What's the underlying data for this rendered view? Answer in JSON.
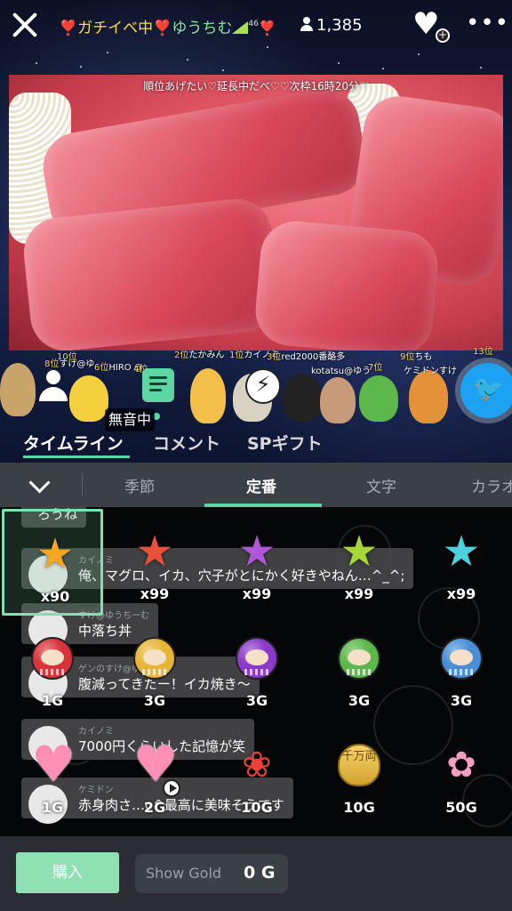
{
  "header": {
    "broadcaster_prefix": "❣️ガチイベ中❣️",
    "broadcaster_name": "ゆうちむ",
    "level": "46",
    "broadcaster_suffix": "❣️",
    "viewer_count": "1,385",
    "icons": {
      "close": "close-icon",
      "follow": "heart-plus-icon",
      "more": "more-icon",
      "viewers": "person-icon"
    }
  },
  "video": {
    "ticker": "順位あげたい♡延長中だべ♡♡次枠16時20分♡"
  },
  "avatar_strip": {
    "ranks": [
      {
        "rank": "8位",
        "name": "すけ@ゆ"
      },
      {
        "rank": "10位",
        "name": ""
      },
      {
        "rank": "6位",
        "name": "HIRO @"
      },
      {
        "rank": "4位",
        "name": ""
      },
      {
        "rank": "2位",
        "name": "たかみん"
      },
      {
        "rank": "1位",
        "name": "カイノミ"
      },
      {
        "rank": "3位",
        "name": "red2000番酪多"
      },
      {
        "rank": "",
        "name": "kotatsu@ゆう"
      },
      {
        "rank": "7位",
        "name": ""
      },
      {
        "rank": "9位",
        "name": "ちも"
      },
      {
        "rank": "",
        "name": "ケミドンすけ"
      },
      {
        "rank": "13位",
        "name": ""
      }
    ],
    "mute_badge": "無音中"
  },
  "main_tabs": {
    "timeline": "タイムライン",
    "comment": "コメント",
    "sp_gift": "SPギフト"
  },
  "categories": {
    "items": [
      "季節",
      "定番",
      "文字",
      "カラオ"
    ],
    "active": "定番"
  },
  "chat": [
    {
      "name": "",
      "text": "ろうね"
    },
    {
      "name": "カイノミ",
      "text": "俺、マグロ、イカ、穴子がとにかく好きやねん…^_^;"
    },
    {
      "name": "すけ@ゆうちーむ",
      "text": "中落ち丼"
    },
    {
      "name": "ゲンのすけ@ゆうち",
      "text": "腹減ってきたー！イカ焼き〜"
    },
    {
      "name": "カイノミ",
      "text": "7000円くらいした記憶が笑"
    },
    {
      "name": "ケミドン",
      "text": "赤身肉さ…o^最高に美味そうです"
    }
  ],
  "gifts": [
    {
      "label": "x90",
      "icon": "star-orange-icon",
      "color": "#f5a623",
      "selected": true
    },
    {
      "label": "x99",
      "icon": "star-red-icon",
      "color": "#e8503a",
      "selected": false
    },
    {
      "label": "x99",
      "icon": "star-purple-icon",
      "color": "#b057d8",
      "selected": false
    },
    {
      "label": "x99",
      "icon": "star-green-icon",
      "color": "#a6d63a",
      "selected": false
    },
    {
      "label": "x99",
      "icon": "star-cyan-icon",
      "color": "#4fd0de",
      "selected": false
    },
    {
      "label": "1G",
      "icon": "daruma-red-icon",
      "color": "#d8323a",
      "selected": false
    },
    {
      "label": "3G",
      "icon": "daruma-gold-icon",
      "color": "#e8b634",
      "selected": false
    },
    {
      "label": "3G",
      "icon": "daruma-purple-icon",
      "color": "#8a3ac8",
      "selected": false
    },
    {
      "label": "3G",
      "icon": "daruma-green-icon",
      "color": "#5cb84a",
      "selected": false
    },
    {
      "label": "3G",
      "icon": "daruma-blue-icon",
      "color": "#4a8ed8",
      "selected": false
    },
    {
      "label": "1G",
      "icon": "heart-icon",
      "color": "#ff8fb4",
      "selected": false
    },
    {
      "label": "2G",
      "icon": "heart-play-icon",
      "color": "#ff8fb4",
      "selected": false
    },
    {
      "label": "10G",
      "icon": "rose-icon",
      "color": "#e8423a",
      "selected": false
    },
    {
      "label": "10G",
      "icon": "gold-coin-icon",
      "color": "#e2b540",
      "selected": false
    },
    {
      "label": "50G",
      "icon": "bouquet-icon",
      "color": "#f3a0c0",
      "selected": false
    }
  ],
  "coin_text": "千万両",
  "footer": {
    "buy_label": "購入",
    "gold_label": "Show Gold",
    "gold_value": "0 G"
  },
  "colors": {
    "accent": "#5ed6a4",
    "panel_bg": "#2a2d33",
    "category_bar_bg": "#3b3f46",
    "buy_button": "#8fe0b2"
  }
}
